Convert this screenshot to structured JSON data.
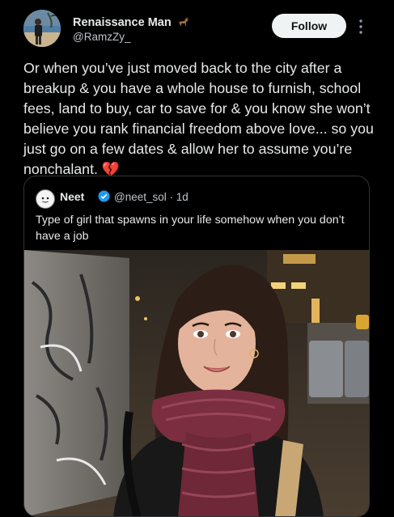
{
  "author": {
    "display_name": "Renaissance Man",
    "handle": "@RamzZy_",
    "name_badge_icon": "horse-emoji-icon",
    "avatar_icon": "profile-photo-person-on-beach"
  },
  "actions": {
    "follow_label": "Follow",
    "more_icon": "vertical-ellipsis-icon"
  },
  "post": {
    "text": "Or when you’ve just moved back to the city after a breakup & you have a whole house to furnish, school fees, land to buy, car to save for & you know she won’t believe you rank financial freedom above love... so you just go on a few dates & allow her to assume you’re nonchalant. 💔"
  },
  "quoted_post": {
    "display_name": "Neet",
    "handle": "@neet_sol",
    "separator": "·",
    "time": "1d",
    "verified_icon": "blue-verified-badge-icon",
    "text": "Type of girl that spawns in your life somehow when you don’t have a job",
    "media_icon": "photo-woman-with-maroon-scarf-city-street-night"
  },
  "colors": {
    "background": "#000000",
    "text_primary": "#e7e9ea",
    "text_secondary": "#bfc5ca",
    "follow_bg": "#eff3f4",
    "border": "#2f3336",
    "verified_blue": "#1d9bf0"
  }
}
